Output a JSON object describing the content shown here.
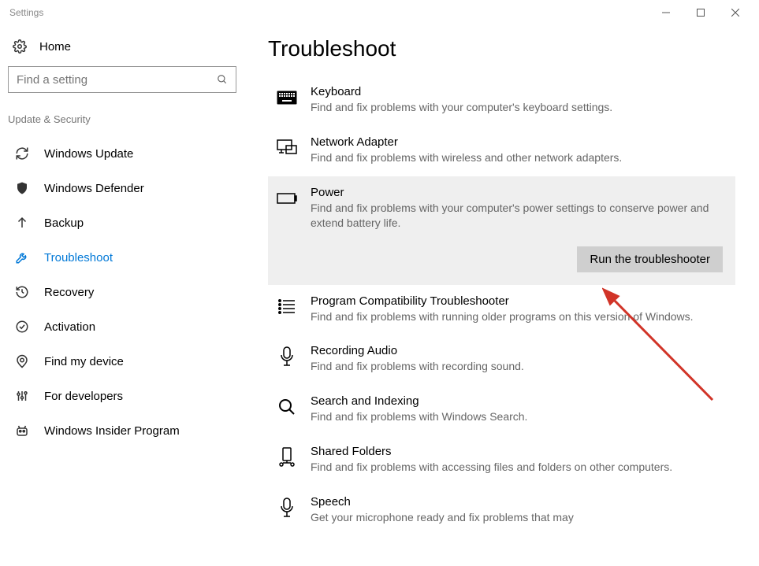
{
  "window": {
    "title": "Settings"
  },
  "sidebar": {
    "home_label": "Home",
    "search_placeholder": "Find a setting",
    "section_label": "Update & Security",
    "items": [
      {
        "label": "Windows Update"
      },
      {
        "label": "Windows Defender"
      },
      {
        "label": "Backup"
      },
      {
        "label": "Troubleshoot"
      },
      {
        "label": "Recovery"
      },
      {
        "label": "Activation"
      },
      {
        "label": "Find my device"
      },
      {
        "label": "For developers"
      },
      {
        "label": "Windows Insider Program"
      }
    ]
  },
  "main": {
    "title": "Troubleshoot",
    "run_button_label": "Run the troubleshooter",
    "items": [
      {
        "title": "Keyboard",
        "desc": "Find and fix problems with your computer's keyboard settings."
      },
      {
        "title": "Network Adapter",
        "desc": "Find and fix problems with wireless and other network adapters."
      },
      {
        "title": "Power",
        "desc": "Find and fix problems with your computer's power settings to conserve power and extend battery life."
      },
      {
        "title": "Program Compatibility Troubleshooter",
        "desc": "Find and fix problems with running older programs on this version of Windows."
      },
      {
        "title": "Recording Audio",
        "desc": "Find and fix problems with recording sound."
      },
      {
        "title": "Search and Indexing",
        "desc": "Find and fix problems with Windows Search."
      },
      {
        "title": "Shared Folders",
        "desc": "Find and fix problems with accessing files and folders on other computers."
      },
      {
        "title": "Speech",
        "desc": "Get your microphone ready and fix problems that may"
      }
    ]
  }
}
